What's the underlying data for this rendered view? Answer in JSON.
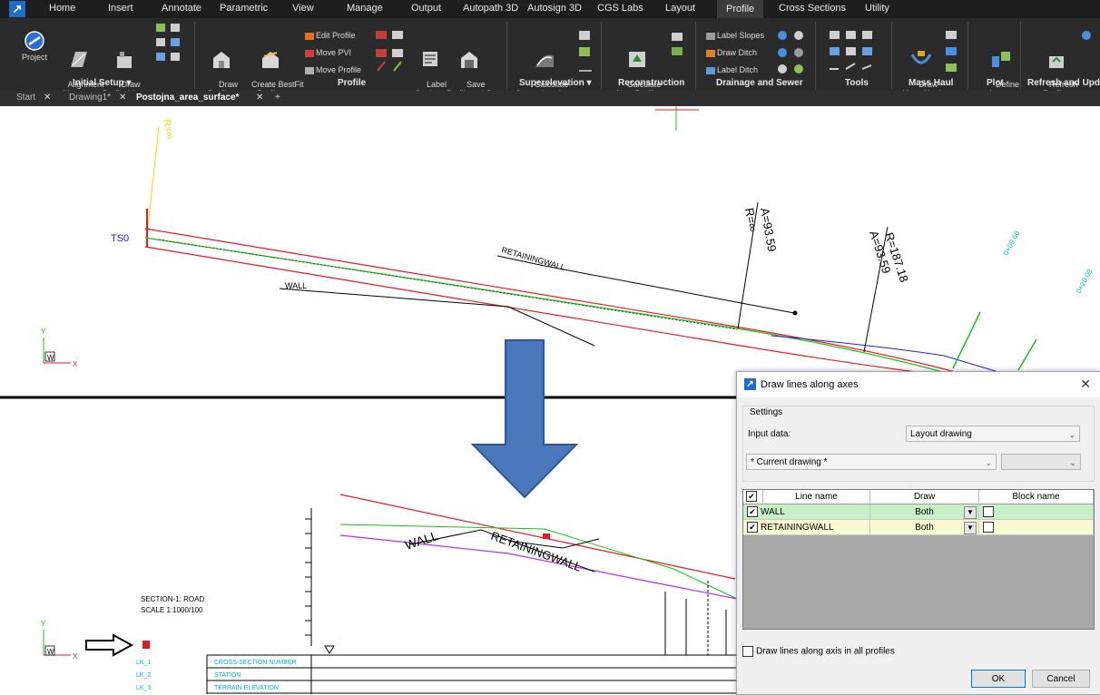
{
  "ribbon": {
    "tabs": [
      "Home",
      "Insert",
      "Annotate",
      "Parametric",
      "View",
      "Manage",
      "Output",
      "Autopath 3D",
      "Autosign 3D",
      "CGS Labs",
      "Layout",
      "Profile",
      "Cross Sections",
      "Utility"
    ],
    "active_tab": "Profile",
    "groups": {
      "initial_setup": {
        "label": "Initial Setup ▾",
        "project": "Project",
        "alignment_manager": "Alignment\nManager",
        "draw_profile_view": "Draw\nProfile View"
      },
      "profile": {
        "label": "Profile",
        "draw_profile": "Draw\nProfile▾",
        "create_bestfit": "Create BestFit\nProfile▾",
        "edit_profile": "Edit Profile",
        "move_pvi": "Move PVI",
        "move_profile": "Move Profile",
        "label_settings": "Label\nSettings",
        "save_profile": "Save\nProfile -> LS"
      },
      "superelevation": {
        "label": "Superelevation ▾",
        "calculate": "Calculate\nSuperelevations"
      },
      "reconstruction": {
        "label": "Reconstruction",
        "calculate_new": "Calculate\nNew Profile"
      },
      "drainage": {
        "label": "Drainage and Sewer",
        "label_slopes": "Label Slopes",
        "draw_ditch": "Draw Ditch",
        "label_ditch": "Label Ditch"
      },
      "tools": {
        "label": "Tools"
      },
      "mass_haul": {
        "label": "Mass Haul",
        "draw": "Draw\nMass Haul"
      },
      "plot": {
        "label": "Plot",
        "define_areas": "Define\nAreas▾"
      },
      "refresh": {
        "label": "Refresh and Upd",
        "refresh_profiles": "Refresh\nProfiles"
      }
    },
    "doc_tabs": {
      "start": "Start",
      "drawing1": "Drawing1*",
      "active": "Postojna_area_surface*",
      "plus": "+"
    }
  },
  "drawing": {
    "top": {
      "label_r_inf_top": "R=∞",
      "label_tso": "TS0",
      "label_retainingwall": "RETAININGWALL",
      "label_wall": "WALL",
      "label_a1": "A=93.59",
      "label_r1": "R=∞",
      "label_r2": "R=187.18",
      "label_a2": "A=93.59",
      "label_station1": "0+09.60",
      "label_station2": "0+20.09",
      "ucs_y": "Y",
      "ucs_x": "X",
      "ucs_w": "W"
    },
    "bottom": {
      "label_wall": "WALL",
      "label_retainingwall": "RETAININGWALL",
      "section_title": "SECTION-1: ROAD",
      "section_scale": "SCALE 1:1000/100",
      "rows": [
        {
          "code": "LK_1",
          "name": "CROSS-SECTION NUMBER"
        },
        {
          "code": "LK_2",
          "name": "STATION"
        },
        {
          "code": "LK_3",
          "name": "TERRAIN ELEVATION"
        }
      ],
      "ucs_y": "Y",
      "ucs_x": "X",
      "ucs_w": "W"
    }
  },
  "dialog": {
    "title": "Draw lines along axes",
    "settings_label": "Settings",
    "input_data_label": "Input data:",
    "input_data_value": "Layout drawing",
    "drawing_value": "* Current drawing *",
    "columns": [
      "Line name",
      "Draw",
      "Block name"
    ],
    "rows": [
      {
        "name": "WALL",
        "draw": "Both",
        "checked": true,
        "color": "#c8f0c8"
      },
      {
        "name": "RETAININGWALL",
        "draw": "Both",
        "checked": true,
        "color": "#fafad2"
      }
    ],
    "all_profiles_label": "Draw lines along axis in all profiles",
    "ok": "OK",
    "cancel": "Cancel"
  },
  "colors": {
    "ribbon_bg": "#2b2b2b",
    "arrow_fill": "#4a78bd",
    "red_line": "#e8191c",
    "green_line": "#16c01a",
    "blue_line": "#2020d8",
    "magenta_line": "#b030e8"
  }
}
